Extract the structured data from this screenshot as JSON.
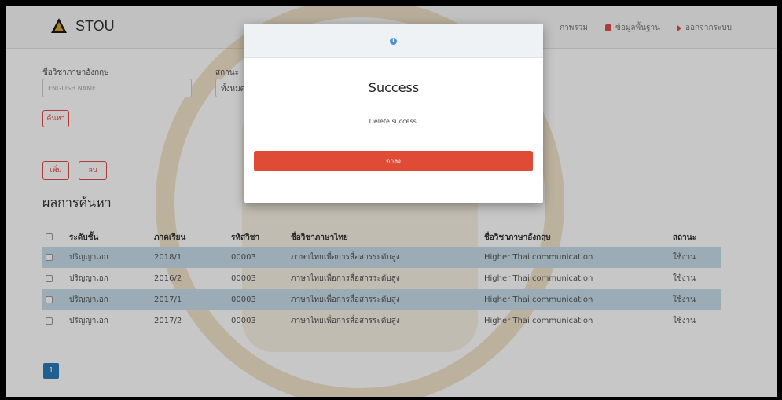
{
  "navbar": {
    "brand": "STOU",
    "links": [
      {
        "label": "ภาพรวม",
        "icon": "none"
      },
      {
        "label": "ข้อมูลพื้นฐาน",
        "icon": "database-icon"
      },
      {
        "label": "ออกจากระบบ",
        "icon": "logout-icon"
      }
    ]
  },
  "form": {
    "english_name_label": "ชื่อวิชาภาษาอังกฤษ",
    "english_name_placeholder": "ENGLISH NAME",
    "status_label": "สถานะ",
    "status_value": "ทั้งหมด",
    "search_button": "ค้นหา",
    "add_button": "เพิ่ม",
    "delete_button": "ลบ"
  },
  "results": {
    "title": "ผลการค้นหา",
    "columns": [
      "ระดับชั้น",
      "ภาคเรียน",
      "รหัสวิชา",
      "ชื่อวิชาภาษาไทย",
      "ชื่อวิชาภาษาอังกฤษ",
      "สถานะ"
    ],
    "rows": [
      [
        "ปริญญาเอก",
        "2018/1",
        "00003",
        "ภาษาไทยเพื่อการสื่อสารระดับสูง",
        "Higher Thai communication",
        "ใช้งาน"
      ],
      [
        "ปริญญาเอก",
        "2016/2",
        "00003",
        "ภาษาไทยเพื่อการสื่อสารระดับสูง",
        "Higher Thai communication",
        "ใช้งาน"
      ],
      [
        "ปริญญาเอก",
        "2017/1",
        "00003",
        "ภาษาไทยเพื่อการสื่อสารระดับสูง",
        "Higher Thai communication",
        "ใช้งาน"
      ],
      [
        "ปริญญาเอก",
        "2017/2",
        "00003",
        "ภาษาไทยเพื่อการสื่อสารระดับสูง",
        "Higher Thai communication",
        "ใช้งาน"
      ]
    ]
  },
  "pagination": {
    "current": "1"
  },
  "modal": {
    "title": "Success",
    "message": "Delete success.",
    "ok_button": "ตกลง"
  }
}
